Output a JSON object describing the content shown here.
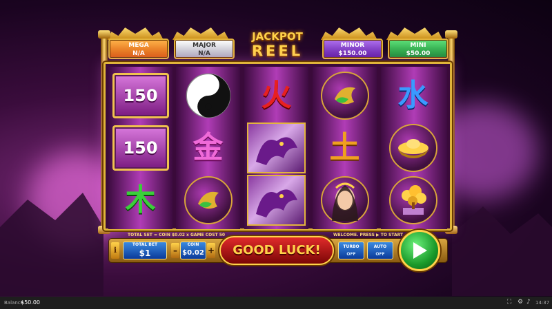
{
  "jackpots": [
    {
      "name": "MEGA",
      "value": "N/A",
      "bg": "#f07a1a"
    },
    {
      "name": "MAJOR",
      "value": "N/A",
      "bg": "#d8d8e0"
    },
    {
      "name": "MINOR",
      "value": "$150.00",
      "bg": "#8a3ad0"
    },
    {
      "name": "MINI",
      "value": "$50.00",
      "bg": "#2aa84a"
    }
  ],
  "title": {
    "line1": "JACKPOT",
    "line2": "REEL"
  },
  "reels": [
    [
      "150",
      "150",
      "木"
    ],
    [
      "yin-yang",
      "金",
      "koi"
    ],
    [
      "火",
      "dragon",
      "dragon"
    ],
    [
      "koi",
      "土",
      "empress"
    ],
    [
      "水",
      "gold-ingot",
      "money-tree"
    ]
  ],
  "info": {
    "formula": "TOTAL SET = COIN $0.02 x GAME COST 50",
    "welcome": "WELCOME. PRESS ▶ TO START"
  },
  "controls": {
    "info_icon": "i",
    "total_bet_label": "TOTAL BET",
    "total_bet_value": "$1",
    "minus": "–",
    "coin_label": "COIN",
    "coin_value": "$0.02",
    "plus": "+",
    "message": "GOOD LUCK!",
    "turbo_label": "TURBO",
    "turbo_state": "OFF",
    "auto_label": "AUTO",
    "auto_state": "OFF"
  },
  "status": {
    "balance_label": "Balance",
    "balance_value": "$50.00",
    "time": "14:37"
  },
  "colors": {
    "gold": "#e3b43d",
    "green_glyph": "#3ad03a",
    "red_glyph": "#e82020",
    "blue_glyph": "#2a7aff",
    "spin": "#2ac040"
  }
}
